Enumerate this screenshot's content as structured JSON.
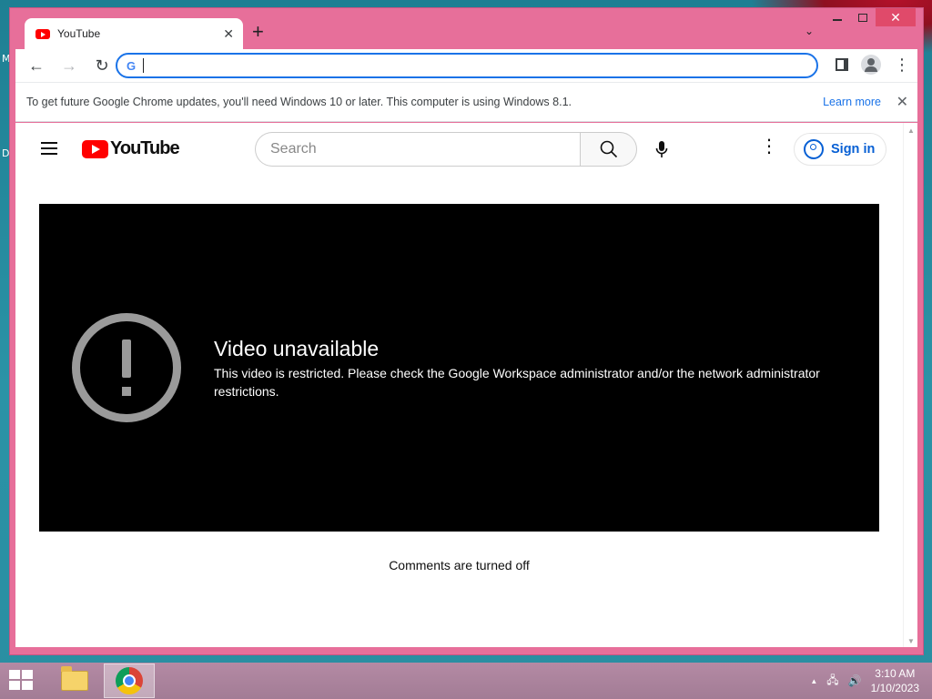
{
  "desktop": {
    "edge_letters": [
      "M",
      "D"
    ]
  },
  "browser": {
    "tab": {
      "title": "YouTube",
      "close": "✕"
    },
    "new_tab": "+",
    "tab_search": "⌄",
    "window_controls": {
      "close": "✕"
    },
    "nav": {
      "back": "←",
      "forward": "→",
      "reload": "↻"
    },
    "omnibox": {
      "g_logo": "G",
      "value": ""
    },
    "menu": "⋮",
    "infobar": {
      "message": "To get future Google Chrome updates, you'll need Windows 10 or later. This computer is using Windows 8.1.",
      "link": "Learn more",
      "close": "✕"
    }
  },
  "youtube": {
    "logo_text": "YouTube",
    "search_placeholder": "Search",
    "search_icon": "⌕",
    "more": "⋮",
    "sign_in": "Sign in",
    "error": {
      "title": "Video unavailable",
      "message": "This video is restricted. Please check the Google Workspace administrator and/or the network administrator restrictions."
    },
    "comments_status": "Comments are turned off"
  },
  "scrollbar": {
    "up": "▲",
    "down": "▼"
  },
  "taskbar": {
    "tray": {
      "chevron": "▲",
      "network": "🖧",
      "volume": "🔊"
    },
    "clock": {
      "time": "3:10 AM",
      "date": "1/10/2023"
    }
  }
}
